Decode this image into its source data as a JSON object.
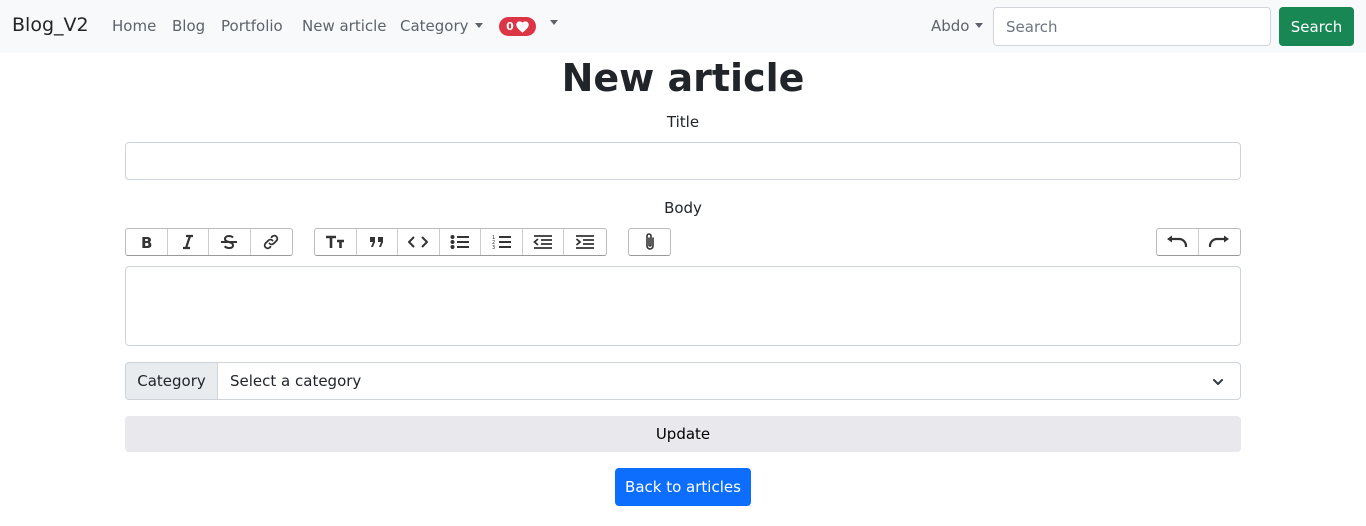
{
  "navbar": {
    "brand": "Blog_V2",
    "links": [
      "Home",
      "Blog",
      "Portfolio",
      "New article"
    ],
    "category_label": "Category",
    "badge_count": "0",
    "badge_icon": "heart-icon",
    "user_name": "Abdo",
    "search_placeholder": "Search",
    "search_button": "Search"
  },
  "form": {
    "heading": "New article",
    "title_label": "Title",
    "title_value": "",
    "body_label": "Body",
    "toolbar": {
      "text_tools": [
        "bold-icon",
        "italic-icon",
        "strikethrough-icon",
        "link-icon"
      ],
      "block_tools": [
        "heading-icon",
        "quote-icon",
        "code-icon",
        "bullet-list-icon",
        "numbered-list-icon",
        "decrease-indent-icon",
        "increase-indent-icon"
      ],
      "file_tools": [
        "attach-file-icon"
      ],
      "history_tools": [
        "undo-icon",
        "redo-icon"
      ]
    },
    "body_value": "",
    "category_prefix": "Category",
    "category_selected": "Select a category",
    "update_button": "Update",
    "back_button": "Back to articles"
  },
  "colors": {
    "navbar_bg": "#f8f9fa",
    "search_button": "#198754",
    "badge": "#dc3545",
    "back_button": "#0d6efd",
    "update_button": "#e9e9ed"
  }
}
